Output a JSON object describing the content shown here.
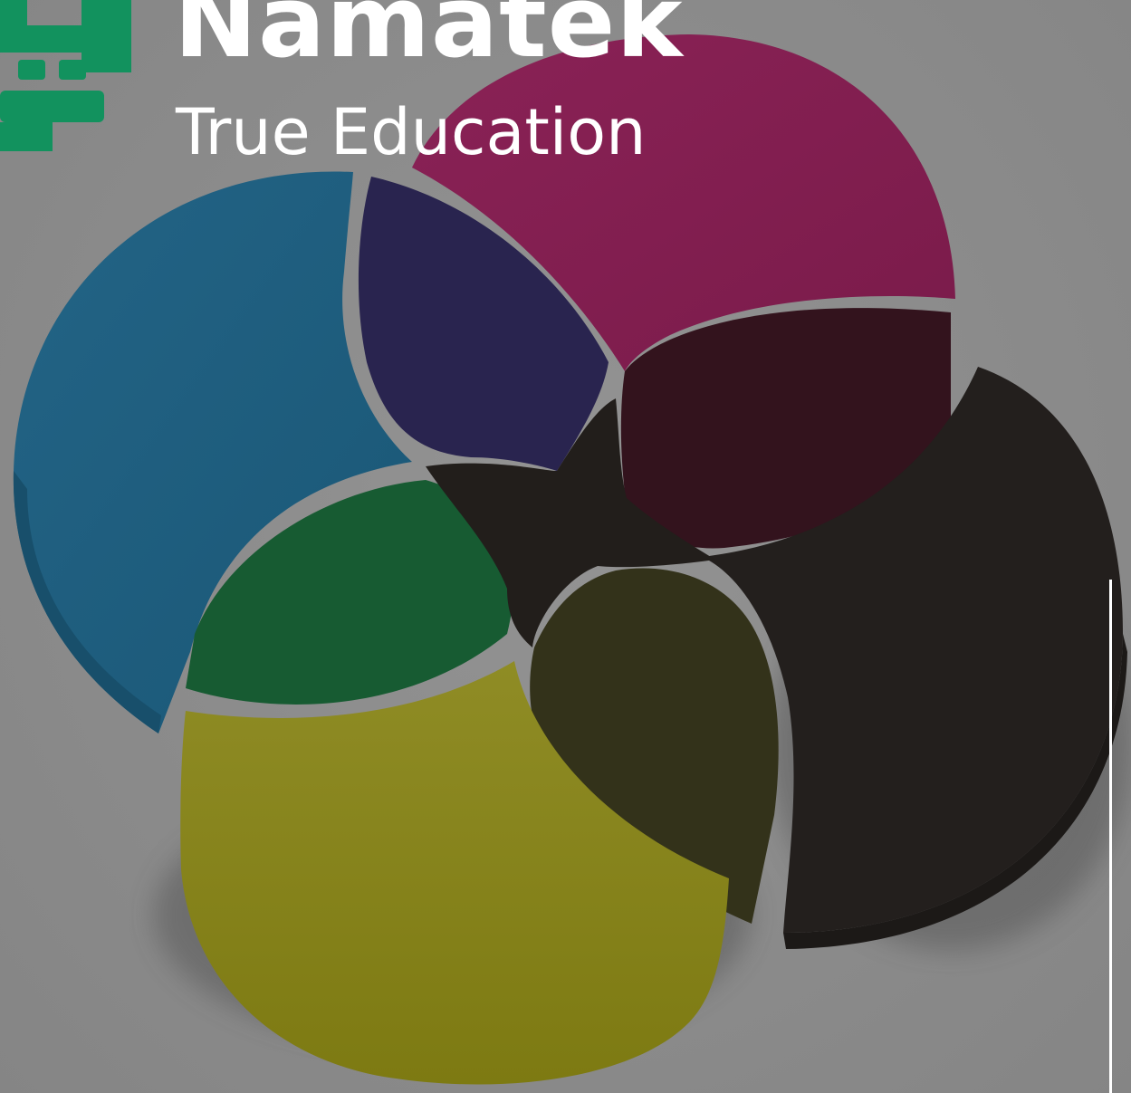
{
  "brand": {
    "name": "Namatek",
    "tagline": "True Education",
    "logo_icon": "namatek-logo-icon",
    "logo_color": "#12925e",
    "text_color": "#ffffff"
  },
  "illustration": {
    "subject": "seven-petal-pie-icon",
    "segment_colors": {
      "blue": "#1e5f82",
      "indigo": "#2a2554",
      "magenta": "#821e50",
      "black": "#221f1d",
      "dark-maroon": "#35141e",
      "green": "#175b33",
      "olive": "#33321a",
      "yellow": "#89861f",
      "center": "#231f1c"
    }
  }
}
